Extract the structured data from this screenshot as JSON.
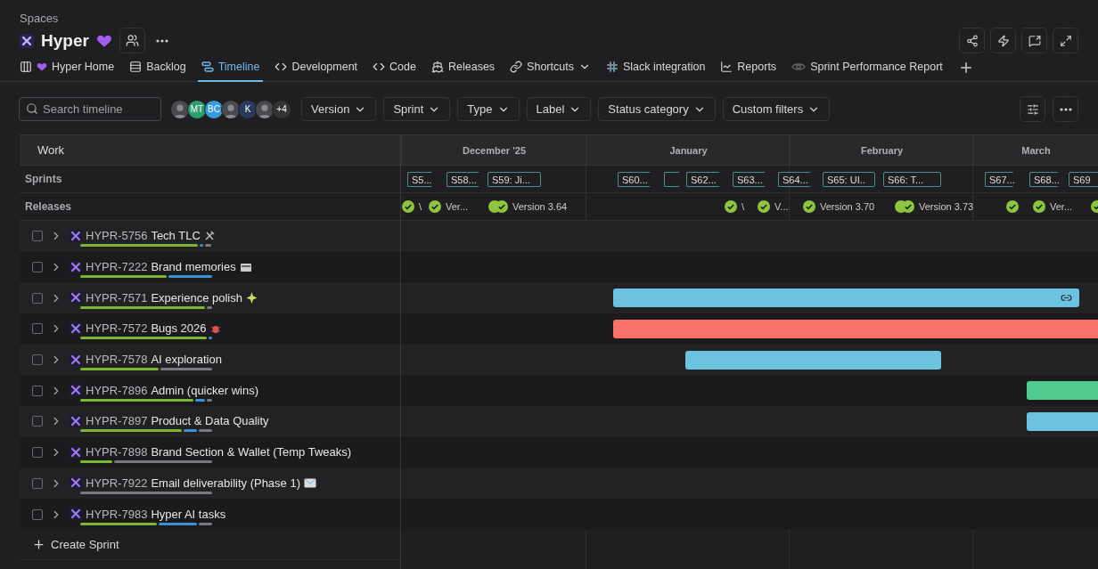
{
  "breadcrumb": "Spaces",
  "space": {
    "title": "Hyper"
  },
  "tabs": [
    {
      "label": "Hyper Home",
      "selected": false
    },
    {
      "label": "Backlog",
      "selected": false
    },
    {
      "label": "Timeline",
      "selected": true
    },
    {
      "label": "Development",
      "selected": false
    },
    {
      "label": "Code",
      "selected": false
    },
    {
      "label": "Releases",
      "selected": false
    },
    {
      "label": "Shortcuts",
      "selected": false
    },
    {
      "label": "Slack integration",
      "selected": false
    },
    {
      "label": "Reports",
      "selected": false
    },
    {
      "label": "Sprint Performance Report",
      "selected": false
    }
  ],
  "search": {
    "placeholder": "Search timeline"
  },
  "avatars": [
    {
      "kind": "photo"
    },
    {
      "kind": "initials",
      "text": "MT",
      "color": "#2f9e6e"
    },
    {
      "kind": "initials",
      "text": "BC",
      "color": "#3a9bd9"
    },
    {
      "kind": "photo"
    },
    {
      "kind": "initials",
      "text": "K",
      "color": "#2b3a5c"
    },
    {
      "kind": "photo"
    },
    {
      "kind": "more",
      "text": "+4"
    }
  ],
  "filters": [
    "Version",
    "Sprint",
    "Type",
    "Label",
    "Status category",
    "Custom filters"
  ],
  "timeline": {
    "work_header": "Work",
    "sprints_label": "Sprints",
    "releases_label": "Releases",
    "months": [
      "December '25",
      "January",
      "February",
      "March"
    ],
    "sprints": [
      {
        "label": "S5...",
        "kind": "arrow"
      },
      {
        "label": "S58...",
        "kind": "arrow"
      },
      {
        "label": "S59: Ji...",
        "kind": "box"
      },
      {
        "label": "S60...",
        "kind": "arrow"
      },
      {
        "kind": "arrow"
      },
      {
        "label": "S62...",
        "kind": "arrow"
      },
      {
        "label": "S63...",
        "kind": "arrow"
      },
      {
        "label": "S64...",
        "kind": "arrow"
      },
      {
        "label": "S65: UI..",
        "kind": "box"
      },
      {
        "label": "S66: T...",
        "kind": "box"
      },
      {
        "label": "S67...",
        "kind": "arrow"
      },
      {
        "label": "S68...",
        "kind": "arrow"
      },
      {
        "label": "S69",
        "kind": "box"
      }
    ],
    "releases": [
      {
        "label": "\\",
        "kind": "single"
      },
      {
        "label": "Ver...",
        "kind": "single"
      },
      {
        "label": "Version 3.64",
        "kind": "double"
      },
      {
        "label": "\\",
        "kind": "single"
      },
      {
        "label": "V...",
        "kind": "single"
      },
      {
        "label": "Version 3.70",
        "kind": "single"
      },
      {
        "label": "Version 3.73",
        "kind": "double"
      },
      {
        "kind": "single"
      },
      {
        "label": "Ver...",
        "kind": "single"
      },
      {
        "kind": "single"
      }
    ],
    "items": [
      {
        "key": "HYPR-5756",
        "title": "Tech TLC",
        "checked": false,
        "progress": [
          {
            "kind": "done"
          },
          {
            "kind": "doing"
          },
          {
            "kind": "todo"
          }
        ]
      },
      {
        "key": "HYPR-7222",
        "title": "Brand memories",
        "checked": false,
        "progress": [
          {
            "kind": "done"
          },
          {
            "kind": "doing"
          }
        ]
      },
      {
        "key": "HYPR-7571",
        "title": "Experience polish",
        "checked": false,
        "progress": [
          {
            "kind": "done"
          },
          {
            "kind": "todo"
          }
        ],
        "bar": {
          "color": "#6cc3e0"
        }
      },
      {
        "key": "HYPR-7572",
        "title": "Bugs 2026",
        "checked": false,
        "progress": [
          {
            "kind": "done"
          },
          {
            "kind": "doing"
          }
        ],
        "bar": {
          "color": "#f7736a"
        }
      },
      {
        "key": "HYPR-7578",
        "title": "AI exploration",
        "checked": false,
        "progress": [
          {
            "kind": "done"
          },
          {
            "kind": "todo"
          }
        ],
        "bar": {
          "color": "#6cc3e0"
        }
      },
      {
        "key": "HYPR-7896",
        "title": "Admin (quicker wins)",
        "checked": false,
        "progress": [
          {
            "kind": "done"
          },
          {
            "kind": "doing"
          },
          {
            "kind": "todo"
          }
        ],
        "bar": {
          "color": "#4fcb92"
        }
      },
      {
        "key": "HYPR-7897",
        "title": "Product & Data Quality",
        "checked": false,
        "progress": [
          {
            "kind": "done"
          },
          {
            "kind": "doing"
          },
          {
            "kind": "todo"
          }
        ],
        "bar": {
          "color": "#6cc3e0"
        }
      },
      {
        "key": "HYPR-7898",
        "title": "Brand Section & Wallet (Temp Tweaks)",
        "checked": false,
        "progress": [
          {
            "kind": "done"
          },
          {
            "kind": "todo"
          }
        ]
      },
      {
        "key": "HYPR-7922",
        "title": "Email deliverability (Phase 1)",
        "checked": false,
        "progress": [
          {
            "kind": "todo"
          }
        ]
      },
      {
        "key": "HYPR-7983",
        "title": "Hyper AI tasks",
        "checked": false,
        "progress": [
          {
            "kind": "done"
          },
          {
            "kind": "doing"
          },
          {
            "kind": "todo"
          }
        ]
      }
    ],
    "create": "Create Sprint"
  }
}
